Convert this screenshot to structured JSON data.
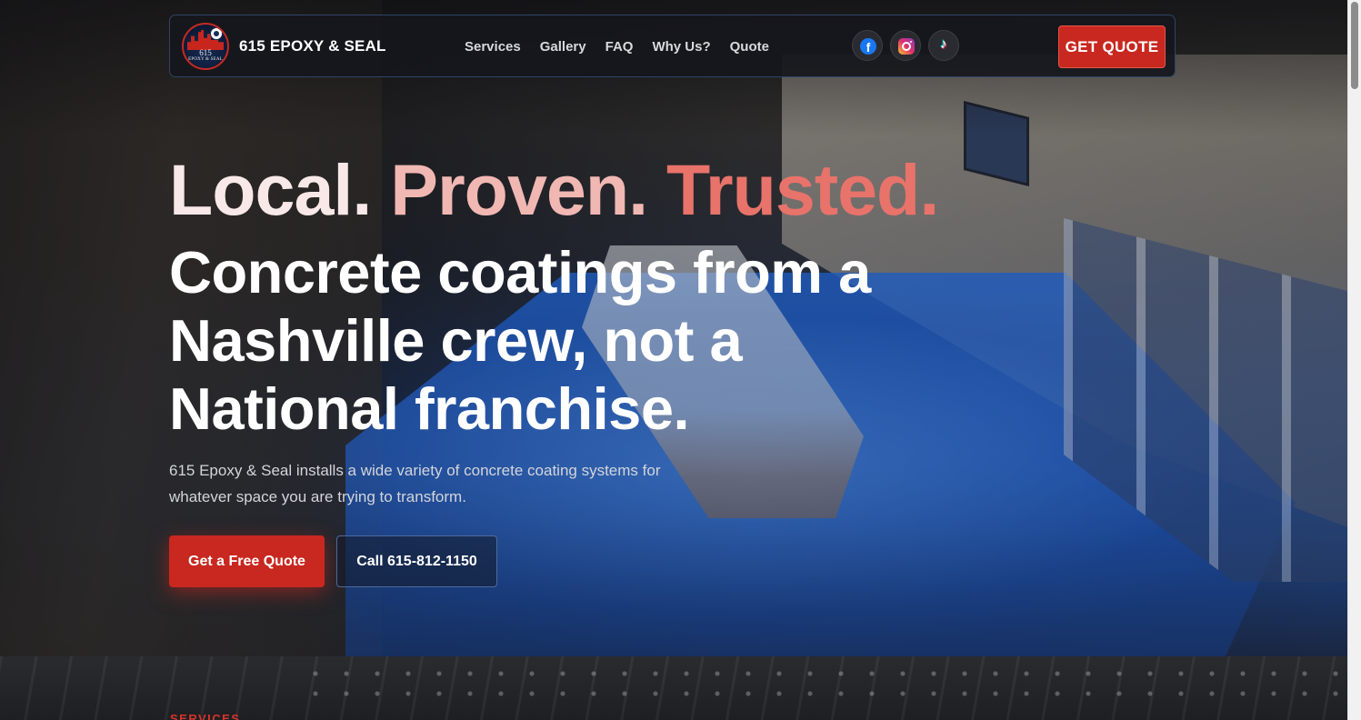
{
  "brand": {
    "name": "615 EPOXY & SEAL",
    "logo_line1": "615",
    "logo_line2": "EPOXY & SEAL"
  },
  "nav": {
    "items": [
      "Services",
      "Gallery",
      "FAQ",
      "Why Us?",
      "Quote"
    ],
    "socials": [
      {
        "icon": "facebook-icon",
        "glyph": "f"
      },
      {
        "icon": "instagram-icon",
        "glyph": ""
      },
      {
        "icon": "tiktok-icon",
        "glyph": "♪"
      }
    ],
    "cta_label": "GET QUOTE"
  },
  "hero": {
    "tagline": [
      "Local.",
      "Proven.",
      "Trusted."
    ],
    "headline_lines": [
      "Concrete coatings from a",
      "Nashville crew, not a",
      "National franchise."
    ],
    "subtitle": "615 Epoxy & Seal installs a wide variety of concrete coating systems for whatever space you are trying to transform.",
    "primary_button": "Get a Free Quote",
    "secondary_button": "Call 615-812-1150"
  },
  "services": {
    "eyebrow": "SERVICES"
  },
  "colors": {
    "accent_red": "#c8281f",
    "tagline_local": "#f8e8e8",
    "tagline_proven": "#f1b7b2",
    "tagline_trusted": "#e8736b",
    "nav_border": "#2f4468"
  }
}
